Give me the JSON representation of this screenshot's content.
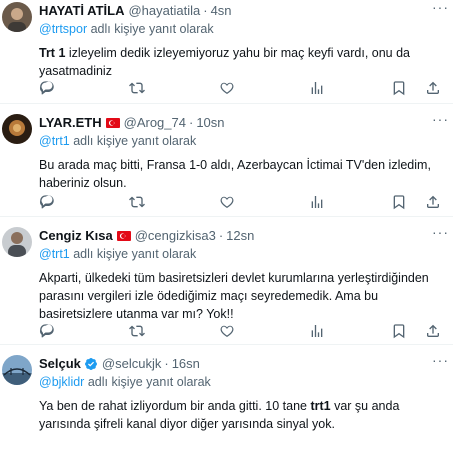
{
  "tweets": [
    {
      "display_name": "HAYATİ ATİLA",
      "handle": "@hayatiatila",
      "separator": "·",
      "time": "4sn",
      "reply_mention": "@trtspor",
      "reply_suffix": " adlı kişiye yanıt olarak",
      "text_bold": "Trt 1",
      "text_rest": " izleyelim dedik izleyemiyoruz yahu bir maç keyfi vardı, onu da yasatmadiniz",
      "has_flag": false,
      "verified": false
    },
    {
      "display_name": "LYAR.ETH",
      "handle": "@Arog_74",
      "separator": "·",
      "time": "10sn",
      "reply_mention": "@trt1",
      "reply_suffix": " adlı kişiye yanıt olarak",
      "text": "Bu arada maç bitti, Fransa 1-0 aldı, Azerbaycan İctimai TV'den izledim, haberiniz olsun.",
      "has_flag": true,
      "verified": false
    },
    {
      "display_name": "Cengiz Kısa",
      "handle": "@cengizkisa3",
      "separator": "·",
      "time": "12sn",
      "reply_mention": "@trt1",
      "reply_suffix": " adlı kişiye yanıt olarak",
      "text": "Akparti, ülkedeki tüm basiretsizleri devlet kurumlarına yerleştirdiğinden parasını vergileri izle ödediğimiz maçı seyredemedik. Ama bu basiretsizlere utanma var mı? Yok!!",
      "has_flag": true,
      "verified": false
    },
    {
      "display_name": "Selçuk",
      "handle": "@selcukjk",
      "separator": "·",
      "time": "16sn",
      "reply_mention": "@bjklidr",
      "reply_suffix": " adlı kişiye yanıt olarak",
      "text_part1": "Ya ben de rahat izliyordum bir anda gitti. 10 tane ",
      "text_bold": "trt1",
      "text_part2": " var şu anda yarısında şifreli kanal diyor diğer yarısında sinyal yok.",
      "has_flag": false,
      "verified": true
    }
  ],
  "icons": {
    "reply": "reply-icon",
    "retweet": "retweet-icon",
    "like": "heart-icon",
    "views": "views-chart-icon",
    "bookmark": "bookmark-icon",
    "share": "share-icon"
  },
  "colors": {
    "link": "#1d9bf0",
    "secondary_text": "#536471",
    "verified": "#1d9bf0",
    "flag_red": "#e30a17"
  }
}
